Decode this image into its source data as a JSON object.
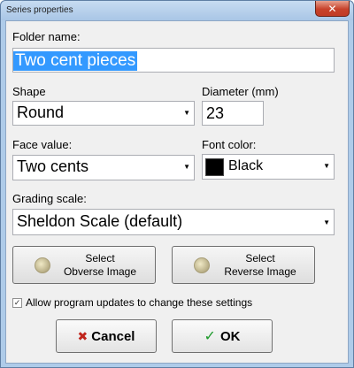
{
  "window": {
    "title": "Series properties",
    "close_symbol": "✕"
  },
  "folder": {
    "label": "Folder name:",
    "value": "Two cent pieces"
  },
  "shape": {
    "label": "Shape",
    "value": "Round"
  },
  "diameter": {
    "label": "Diameter (mm)",
    "value": "23"
  },
  "face_value": {
    "label": "Face value:",
    "value": "Two cents"
  },
  "font_color": {
    "label": "Font color:",
    "value": "Black",
    "swatch": "#000000"
  },
  "grading": {
    "label": "Grading scale:",
    "value": "Sheldon Scale (default)"
  },
  "images": {
    "obverse_line1": "Select",
    "obverse_line2": "Obverse Image",
    "reverse_line1": "Select",
    "reverse_line2": "Reverse Image",
    "icon": "coin-icon"
  },
  "updates": {
    "checked": true,
    "label": "Allow program updates to change these settings"
  },
  "actions": {
    "cancel_label": "Cancel",
    "ok_label": "OK",
    "cancel_icon": "x-icon",
    "ok_icon": "checkmark-icon"
  },
  "colors": {
    "frame": "#aecbe9",
    "selection": "#3399ff",
    "cancel_icon": "#c0241b",
    "ok_icon": "#1e9a2b"
  }
}
